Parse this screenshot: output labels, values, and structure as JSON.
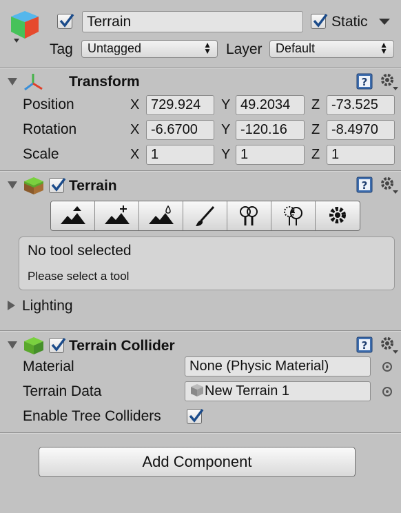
{
  "header": {
    "object_name": "Terrain",
    "active_checked": true,
    "static_label": "Static",
    "static_checked": true,
    "tag_label": "Tag",
    "tag_value": "Untagged",
    "layer_label": "Layer",
    "layer_value": "Default"
  },
  "transform": {
    "title": "Transform",
    "rows": [
      {
        "label": "Position",
        "x": "729.924",
        "y": "49.2034",
        "z": "-73.525"
      },
      {
        "label": "Rotation",
        "x": "-6.6700",
        "y": "-120.16",
        "z": "-8.4970"
      },
      {
        "label": "Scale",
        "x": "1",
        "y": "1",
        "z": "1"
      }
    ],
    "axis_x": "X",
    "axis_y": "Y",
    "axis_z": "Z"
  },
  "terrain": {
    "title": "Terrain",
    "enabled": true,
    "tools": [
      "raise-lower-terrain-icon",
      "paint-height-icon",
      "smooth-height-icon",
      "paint-texture-icon",
      "place-trees-icon",
      "paint-details-icon",
      "terrain-settings-icon"
    ],
    "help_title": "No tool selected",
    "help_text": "Please select a tool",
    "lighting_label": "Lighting"
  },
  "collider": {
    "title": "Terrain Collider",
    "enabled": true,
    "material_label": "Material",
    "material_value": "None (Physic Material)",
    "terrain_data_label": "Terrain Data",
    "terrain_data_value": "New Terrain 1",
    "tree_colliders_label": "Enable Tree Colliders",
    "tree_colliders_checked": true
  },
  "add_component_label": "Add Component",
  "colors": {
    "background": "#c2c2c2",
    "check_blue": "#1b4b8a",
    "help_blue": "#3f6fb0"
  }
}
